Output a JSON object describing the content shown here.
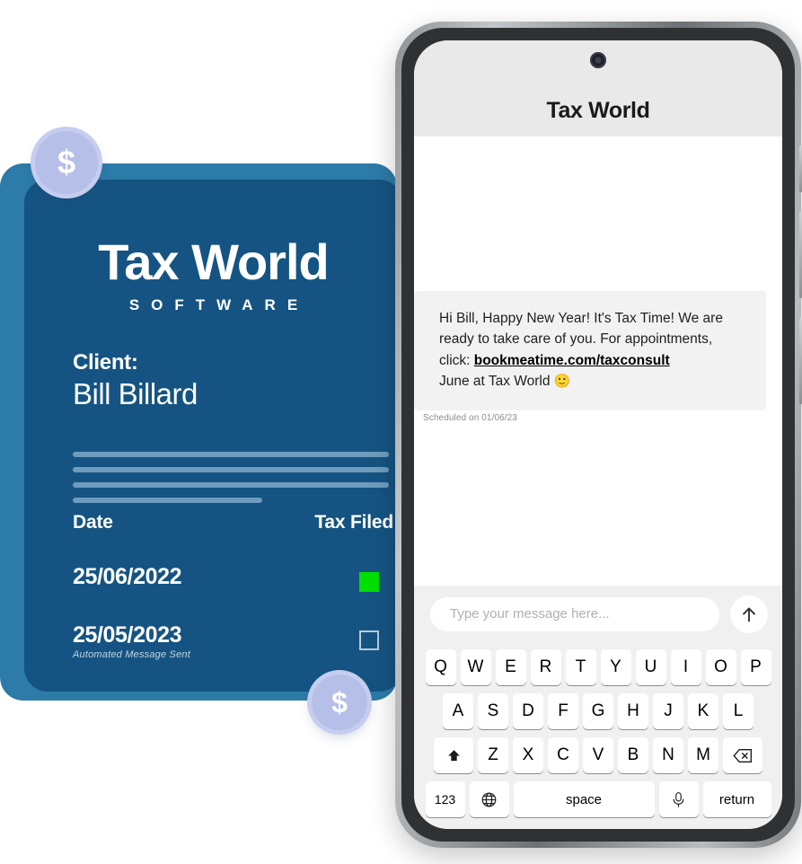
{
  "card": {
    "brand_title": "Tax World",
    "brand_subtitle": "SOFTWARE",
    "client_label": "Client:",
    "client_name": "Bill Billard",
    "coin_symbol": "$",
    "table": {
      "headers": [
        "Date",
        "Tax Filed"
      ],
      "rows": [
        {
          "date": "25/06/2022",
          "note": "",
          "filed": true
        },
        {
          "date": "25/05/2023",
          "note": "Automated Message Sent",
          "filed": false
        }
      ]
    },
    "colors": {
      "card_front": "#155482",
      "card_back": "#2c7ba8",
      "filed_green": "#00e000",
      "coin": "#b6bfe8"
    }
  },
  "phone": {
    "header_title": "Tax World",
    "message": {
      "line1": "Hi Bill, Happy New Year! It's Tax Time! We are",
      "line2": "ready to take care of you. For appointments,",
      "line3_prefix": "click: ",
      "link": "bookmeatime.com/taxconsult",
      "line4": "June at Tax World ",
      "emoji": "🙂",
      "timestamp": "Scheduled on 01/06/23"
    },
    "input": {
      "placeholder": "Type your message here...",
      "value": ""
    },
    "keyboard": {
      "row1": [
        "Q",
        "W",
        "E",
        "R",
        "T",
        "Y",
        "U",
        "I",
        "O",
        "P"
      ],
      "row2": [
        "A",
        "S",
        "D",
        "F",
        "G",
        "H",
        "J",
        "K",
        "L"
      ],
      "row3": [
        "Z",
        "X",
        "C",
        "V",
        "B",
        "N",
        "M"
      ],
      "numeric_key": "123",
      "space_key": "space",
      "return_key": "return"
    }
  }
}
